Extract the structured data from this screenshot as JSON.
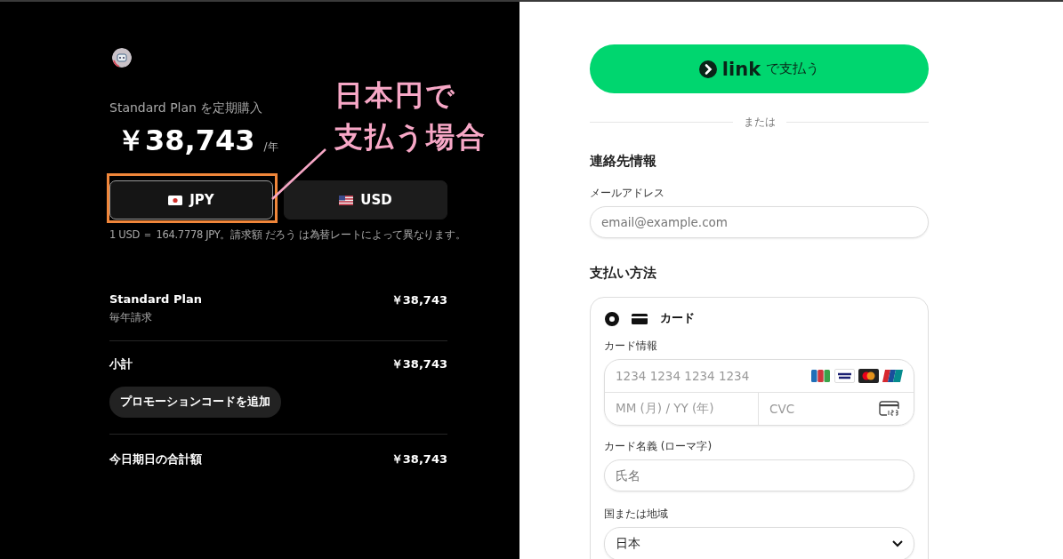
{
  "merchant": {
    "plan_title": "Standard Plan を定期購入",
    "price": "￥38,743",
    "period": "/年"
  },
  "currency_options": [
    {
      "code": "JPY",
      "kind": "jp",
      "selected": true
    },
    {
      "code": "USD",
      "kind": "us",
      "selected": false
    }
  ],
  "exchange_note": "1 USD ＝ 164.7778 JPY。請求額 だろう は為替レートによって異なります。",
  "line_items": [
    {
      "name": "Standard Plan",
      "detail": "毎年請求",
      "amount": "￥38,743"
    }
  ],
  "subtotal": {
    "label": "小計",
    "amount": "￥38,743"
  },
  "promo_button": "プロモーションコードを追加",
  "total": {
    "label": "今日期日の合計額",
    "amount": "￥38,743"
  },
  "link_button": {
    "brand": "link",
    "text": "で支払う"
  },
  "divider_text": "または",
  "contact": {
    "heading": "連絡先情報",
    "email_label": "メールアドレス",
    "email_placeholder": "email@example.com"
  },
  "payment": {
    "heading": "支払い方法",
    "methods": [
      {
        "label": "カード",
        "selected": true
      }
    ],
    "card_info_label": "カード情報",
    "card_number_placeholder": "1234 1234 1234 1234",
    "expiry_placeholder": "MM (月) / YY (年)",
    "cvc_placeholder": "CVC",
    "name_label": "カード名義 (ローマ字)",
    "name_placeholder": "氏名",
    "country_label": "国または地域",
    "country_value": "日本"
  },
  "annotation": {
    "lines": [
      "日本円で",
      "支払う場合"
    ]
  }
}
